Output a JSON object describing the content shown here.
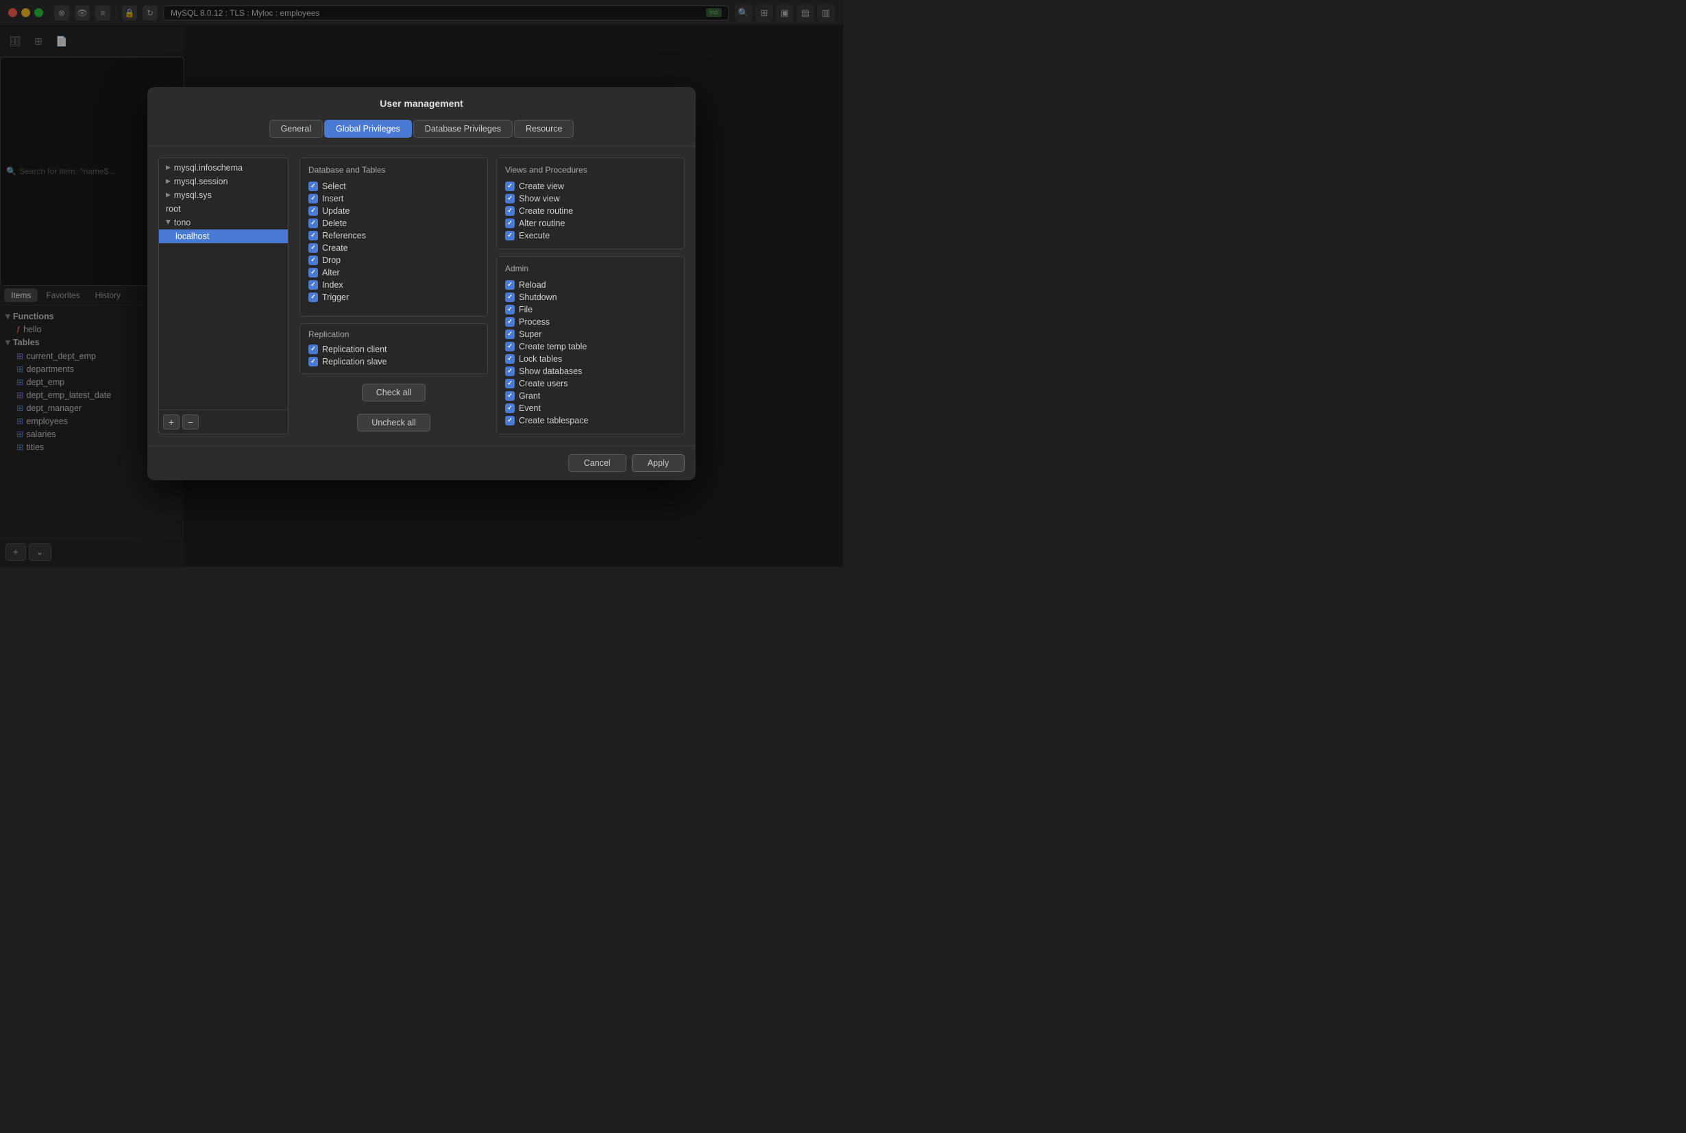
{
  "titlebar": {
    "address": "MySQL 8.0.12 : TLS : Myloc : employees",
    "loc_badge": "loc"
  },
  "sidebar": {
    "search_placeholder": "Search for item: ^name$...",
    "tabs": [
      "Items",
      "Favorites",
      "History"
    ],
    "active_tab": "Items",
    "functions_label": "Functions",
    "hello_label": "hello",
    "tables_label": "Tables",
    "tables": [
      "current_dept_emp",
      "departments",
      "dept_emp",
      "dept_emp_latest_date",
      "dept_manager",
      "employees",
      "salaries",
      "titles"
    ]
  },
  "dialog": {
    "title": "User management",
    "tabs": [
      "General",
      "Global Privileges",
      "Database Privileges",
      "Resource"
    ],
    "active_tab": "Global Privileges",
    "tree": {
      "items": [
        {
          "label": "mysql.infoschema",
          "indent": false,
          "arrow": true
        },
        {
          "label": "mysql.session",
          "indent": false,
          "arrow": true
        },
        {
          "label": "mysql.sys",
          "indent": false,
          "arrow": true
        },
        {
          "label": "root",
          "indent": false,
          "arrow": false
        },
        {
          "label": "tono",
          "indent": false,
          "arrow": true,
          "open": true
        },
        {
          "label": "localhost",
          "indent": true,
          "selected": true
        }
      ]
    },
    "db_tables": {
      "title": "Database and Tables",
      "items": [
        "Select",
        "Insert",
        "Update",
        "Delete",
        "References",
        "Create",
        "Drop",
        "Alter",
        "Index",
        "Trigger"
      ]
    },
    "replication": {
      "title": "Replication",
      "items": [
        "Replication client",
        "Replication slave"
      ]
    },
    "views_procedures": {
      "title": "Views and Procedures",
      "items": [
        "Create view",
        "Show view",
        "Create routine",
        "Alter routine",
        "Execute"
      ]
    },
    "admin": {
      "title": "Admin",
      "items": [
        "Reload",
        "Shutdown",
        "File",
        "Process",
        "Super",
        "Create temp table",
        "Lock tables",
        "Show databases",
        "Create users",
        "Grant",
        "Event",
        "Create tablespace"
      ]
    },
    "check_all": "Check all",
    "uncheck_all": "Uncheck all",
    "cancel": "Cancel",
    "apply": "Apply"
  }
}
